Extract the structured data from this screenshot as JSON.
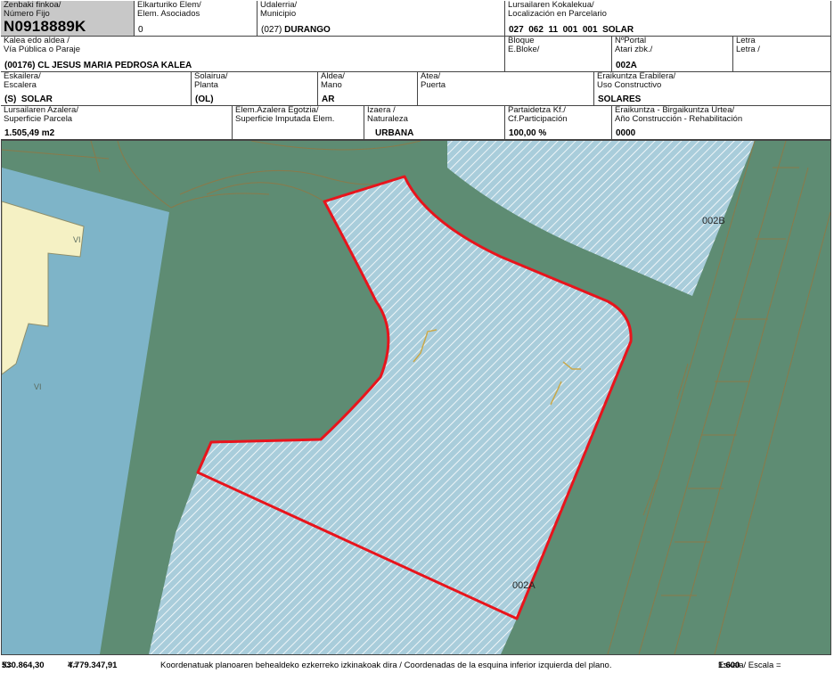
{
  "header": {
    "ref": {
      "label1": "Zenbaki finkoa/",
      "label2": "Número Fijo",
      "value": "N0918889K"
    },
    "elem": {
      "label1": "Elkarturiko Elem/",
      "label2": "Elem. Asociados",
      "value": "0"
    },
    "municipio": {
      "label1": "Udalerria/",
      "label2": "Municipio",
      "code": "(027)",
      "value": "DURANGO"
    },
    "localizacion": {
      "label1": "Lursailaren Kokalekua/",
      "label2": "Localización en Parcelario",
      "value": "027  062  11  001  001  SOLAR"
    },
    "via": {
      "label1": "Kalea edo aldea /",
      "label2": "Vía Pública o Paraje",
      "value": "(00176) CL JESUS MARIA PEDROSA KALEA"
    },
    "bloque": {
      "label1": "Bloque",
      "label2": "E.Bloke/",
      "value": ""
    },
    "portal": {
      "label1": "NºPortal",
      "label2": "Atari zbk./",
      "value": "002A"
    },
    "letra": {
      "label1": "Letra",
      "label2": "Letra /",
      "value": ""
    },
    "escalera": {
      "label1": "Eskailera/",
      "label2": "Escalera",
      "value": "(S)  SOLAR"
    },
    "planta": {
      "label1": "Solairua/",
      "label2": "Planta",
      "value": "(OL)"
    },
    "mano": {
      "label1": "Aldea/",
      "label2": "Mano",
      "value": "AR"
    },
    "puerta": {
      "label1": "Atea/",
      "label2": "Puerta",
      "value": ""
    },
    "uso": {
      "label1": "Eraikuntza Erabilera/",
      "label2": "Uso Constructivo",
      "value": "SOLARES"
    },
    "superficie": {
      "label1": "Lursailaren Azalera/",
      "label2": "Superficie Parcela",
      "value": "1.505,49 m2"
    },
    "imputada": {
      "label1": "Elem.Azalera Egotzia/",
      "label2": "Superficie Imputada Elem.",
      "value": ""
    },
    "naturaleza": {
      "label1": "Izaera /",
      "label2": "Naturaleza",
      "value": "URBANA"
    },
    "participacion": {
      "label1": "Partaidetza Kf./",
      "label2": "Cf.Participación",
      "value": "100,00 %"
    },
    "anio": {
      "label1": "Eraikuntza - Birgaikuntza Urtea/",
      "label2": "Año Construcción - Rehabilitación",
      "value": "0000"
    }
  },
  "map": {
    "labels": {
      "parcel_b": "002B",
      "parcel_a": "002A",
      "vol1": "VI",
      "vol2": "VI"
    },
    "colors": {
      "background": "#5e8c73",
      "street_blue": "#7eb4c8",
      "building_yellow": "#f5f1c4",
      "hatch_fill": "#a9cddb",
      "hatch_line": "#ffffff",
      "selected_outline": "#e8141c",
      "cadastral_line": "#8a7a4a"
    }
  },
  "footer": {
    "x_label": "X=",
    "x_value": "530.864,30",
    "y_label": "Y=",
    "y_value": "4.779.347,91",
    "note": "Koordenatuak planoaren behealdeko ezkerreko izkinakoak dira / Coordenadas de la esquina inferior izquierda del plano.",
    "scale_label": "Eskala/ Escala =",
    "scale_value": "1:600"
  }
}
